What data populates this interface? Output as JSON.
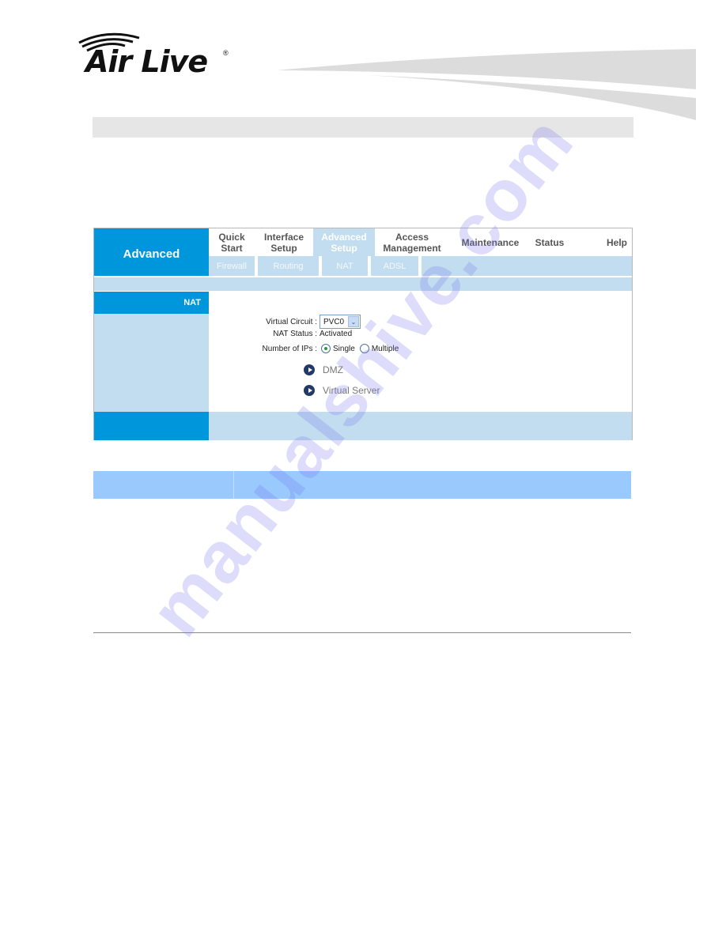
{
  "header": {
    "logo_text": "Air Live",
    "logo_mark": "®"
  },
  "router_ui": {
    "section_title": "Advanced",
    "main_tabs": [
      {
        "label_line1": "Quick",
        "label_line2": "Start",
        "active": false
      },
      {
        "label_line1": "Interface",
        "label_line2": "Setup",
        "active": false
      },
      {
        "label_line1": "Advanced",
        "label_line2": "Setup",
        "active": true
      },
      {
        "label_line1": "Access",
        "label_line2": "Management",
        "active": false
      },
      {
        "label_line1": "Maintenance",
        "label_line2": "",
        "active": false
      },
      {
        "label_line1": "Status",
        "label_line2": "",
        "active": false
      },
      {
        "label_line1": "Help",
        "label_line2": "",
        "active": false
      }
    ],
    "sub_tabs": [
      {
        "label": "Firewall"
      },
      {
        "label": "Routing"
      },
      {
        "label": "NAT"
      },
      {
        "label": "ADSL"
      }
    ],
    "side_label": "NAT",
    "form": {
      "virtual_circuit_label": "Virtual Circuit :",
      "virtual_circuit_value": "PVC0",
      "nat_status_label": "NAT Status :",
      "nat_status_value": "Activated",
      "number_of_ips_label": "Number of IPs :",
      "options": [
        {
          "label": "Single",
          "checked": true
        },
        {
          "label": "Multiple",
          "checked": false
        }
      ]
    },
    "links": [
      {
        "label": "DMZ"
      },
      {
        "label": "Virtual Server"
      }
    ]
  },
  "watermark": "manualshive.com",
  "colors": {
    "brand_blue": "#0096dc",
    "light_blue": "#c2ddef",
    "table_header": "#99c9fd",
    "gray_bar": "#e6e6e6"
  }
}
